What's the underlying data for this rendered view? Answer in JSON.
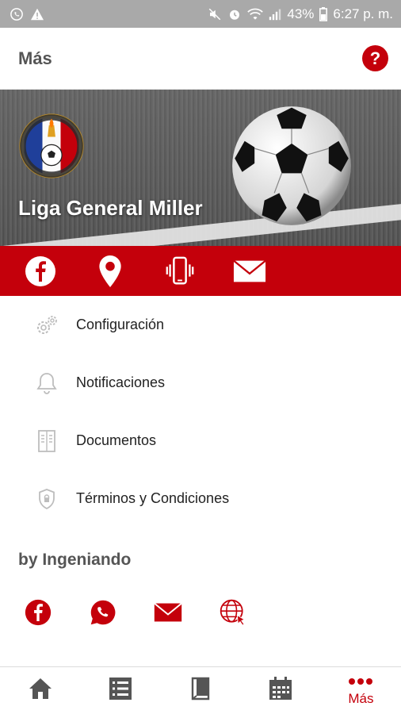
{
  "status_bar": {
    "battery": "43%",
    "time": "6:27 p. m."
  },
  "header": {
    "title": "Más",
    "help_label": "?"
  },
  "hero": {
    "league_name": "Liga General Miller",
    "logo_text": "LIGA DEPORTIVA GENERAL MILLER"
  },
  "contact": {
    "items": [
      {
        "icon": "facebook-icon"
      },
      {
        "icon": "location-pin-icon"
      },
      {
        "icon": "phone-vibrate-icon"
      },
      {
        "icon": "mail-icon"
      }
    ]
  },
  "menu": {
    "items": [
      {
        "label": "Configuración",
        "icon": "gears-icon"
      },
      {
        "label": "Notificaciones",
        "icon": "bell-icon"
      },
      {
        "label": "Documentos",
        "icon": "document-icon"
      },
      {
        "label": "Términos y Condiciones",
        "icon": "shield-icon"
      }
    ]
  },
  "by_section": {
    "title": "by Ingeniando",
    "icons": [
      "facebook-icon",
      "whatsapp-icon",
      "mail-icon",
      "web-icon"
    ]
  },
  "bottom_nav": {
    "items": [
      {
        "icon": "home-icon",
        "label": ""
      },
      {
        "icon": "list-icon",
        "label": ""
      },
      {
        "icon": "book-icon",
        "label": ""
      },
      {
        "icon": "calendar-icon",
        "label": ""
      },
      {
        "icon": "more-icon",
        "label": "Más"
      }
    ]
  },
  "colors": {
    "brand_red": "#c4000b",
    "status_bar": "#a9a9a9",
    "inactive_nav": "#555555"
  }
}
